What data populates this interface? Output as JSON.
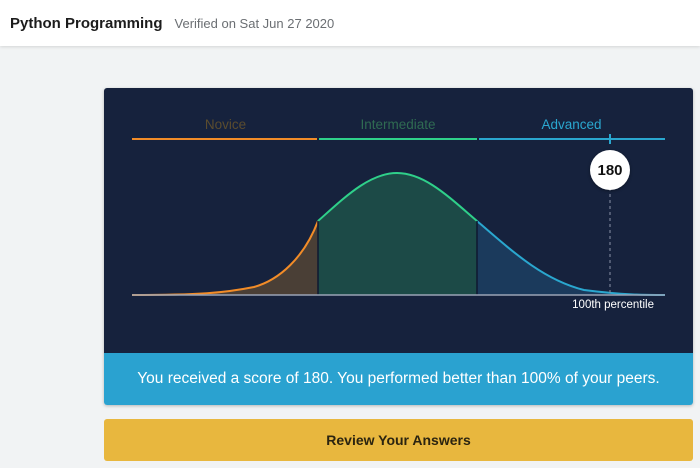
{
  "header": {
    "course_title": "Python Programming",
    "verified_text": "Verified on Sat Jun 27 2020"
  },
  "assessment": {
    "bands": [
      {
        "label": "Novice",
        "color": "#f28c28"
      },
      {
        "label": "Intermediate",
        "color": "#2fd08a"
      },
      {
        "label": "Advanced",
        "color": "#2aa7cf"
      }
    ],
    "score": "180",
    "percentile_label": "100th percentile",
    "result_message": "You received a score of 180. You performed better than 100% of your peers."
  },
  "actions": {
    "review_label": "Review Your Answers"
  },
  "colors": {
    "chart_background": "#16223d",
    "result_bar": "#2aa2d0",
    "review_button": "#e8b73e"
  }
}
